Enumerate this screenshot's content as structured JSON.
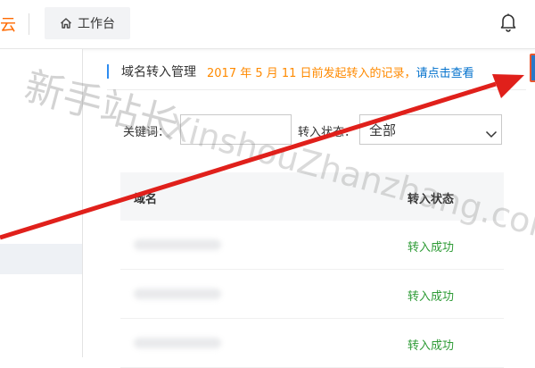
{
  "topbar": {
    "brand_fragment": "云",
    "workbench_label": "工作台",
    "home_icon": "home-icon",
    "bell_icon": "bell-icon"
  },
  "main": {
    "page_title": "域名转入管理",
    "notice_prefix": "2017 年 5 月 11 日前发起转入的记录，",
    "notice_link": "请点击查看"
  },
  "filters": {
    "keyword_label": "关键词：",
    "keyword_value": "",
    "status_label": "转入状态：",
    "status_value": "全部"
  },
  "table": {
    "columns": [
      "域名",
      "转入状态"
    ],
    "rows": [
      {
        "domain": "",
        "status": "转入成功"
      },
      {
        "domain": "",
        "status": "转入成功"
      },
      {
        "domain": "",
        "status": "转入成功"
      }
    ]
  },
  "watermark": {
    "text_cn": "新手站长",
    "text_en": "XinshouZhanzhang.com"
  },
  "colors": {
    "brand": "#ff6a00",
    "notice": "#ff8a00",
    "link": "#0070cc",
    "success": "#2e9b36",
    "annotation_arrow": "#e0201b"
  }
}
